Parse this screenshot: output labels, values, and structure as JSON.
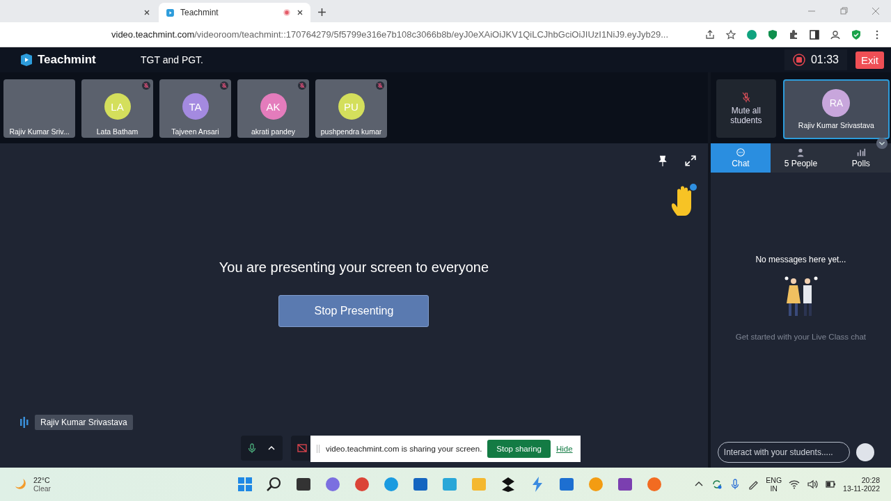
{
  "browser": {
    "tabs": [
      {
        "selected": false
      },
      {
        "title": "Teachmint",
        "selected": true
      }
    ],
    "url_domain": "video.teachmint.com",
    "url_path": "/videoroom/teachmint::170764279/5f5799e316e7b108c3066b8b/eyJ0eXAiOiJKV1QiLCJhbGciOiJIUzI1NiJ9.eyJyb29..."
  },
  "app": {
    "brand": "Teachmint",
    "class_title": "TGT and PGT.",
    "timer": "01:33",
    "exit": "Exit"
  },
  "participants": [
    {
      "kind": "video",
      "name": "Rajiv Kumar Sriv...",
      "muted": false
    },
    {
      "kind": "avatar",
      "initials": "LA",
      "name": "Lata Batham",
      "color": "#d4df5c",
      "muted": true
    },
    {
      "kind": "avatar",
      "initials": "TA",
      "name": "Tajveen Ansari",
      "color": "#a48ae0",
      "muted": true
    },
    {
      "kind": "avatar",
      "initials": "AK",
      "name": "akrati pandey",
      "color": "#e47cbc",
      "muted": true
    },
    {
      "kind": "avatar",
      "initials": "PU",
      "name": "pushpendra kumar",
      "color": "#d4df5c",
      "muted": true
    }
  ],
  "mute_all": "Mute all students",
  "self_tile": {
    "initials": "RA",
    "name": "Rajiv Kumar Srivastava",
    "color": "#c8a6dc"
  },
  "panel_tabs": [
    {
      "kind": "chat",
      "label": "Chat",
      "selected": true
    },
    {
      "kind": "people",
      "label": "5 People",
      "selected": false
    },
    {
      "kind": "polls",
      "label": "Polls",
      "selected": false
    }
  ],
  "chat": {
    "empty_title": "No messages here yet...",
    "empty_hint": "Get started with your Live Class chat",
    "placeholder": "Interact with your students....."
  },
  "stage": {
    "message": "You are presenting your screen to everyone",
    "button": "Stop Presenting",
    "speaker": "Rajiv Kumar Srivastava"
  },
  "share_bar": {
    "text": "video.teachmint.com is sharing your screen.",
    "button": "Stop sharing",
    "link": "Hide"
  },
  "taskbar": {
    "temperature": "22°C",
    "weather": "Clear",
    "apps": [
      {
        "kind": "start"
      },
      {
        "kind": "search"
      },
      {
        "kind": "files"
      },
      {
        "kind": "meet"
      },
      {
        "kind": "chrome"
      },
      {
        "kind": "edge"
      },
      {
        "kind": "store"
      },
      {
        "kind": "monitor"
      },
      {
        "kind": "folder"
      },
      {
        "kind": "dropbox"
      },
      {
        "kind": "bolt"
      },
      {
        "kind": "mail"
      },
      {
        "kind": "browser"
      },
      {
        "kind": "notes"
      },
      {
        "kind": "orange"
      }
    ],
    "lang": "ENG",
    "region": "IN",
    "time": "20:28",
    "date": "13-11-2022"
  }
}
